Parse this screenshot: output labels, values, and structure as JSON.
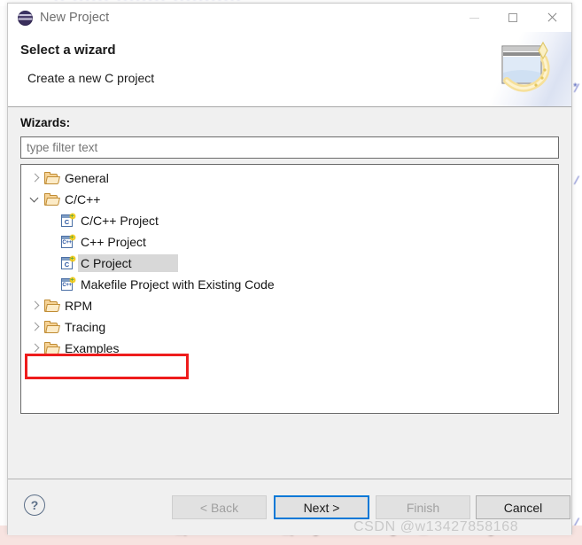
{
  "window": {
    "title": "New Project",
    "icon": "eclipse-logo",
    "controls": {
      "minimize": "—",
      "maximize": "□",
      "close": "✕"
    }
  },
  "header": {
    "title": "Select a wizard",
    "description": "Create a new C project",
    "banner_icon": "wizard-wand-window-icon"
  },
  "body": {
    "wizards_label": "Wizards:",
    "filter": {
      "placeholder": "type filter text",
      "value": ""
    },
    "tree": [
      {
        "label": "General",
        "depth": 0,
        "type": "folder",
        "state": "collapsed",
        "selected": false
      },
      {
        "label": "C/C++",
        "depth": 0,
        "type": "folder",
        "state": "expanded",
        "selected": false
      },
      {
        "label": "C/C++ Project",
        "depth": 1,
        "type": "project-c",
        "icon_letter": "C",
        "selected": false
      },
      {
        "label": "C++ Project",
        "depth": 1,
        "type": "project-cpp",
        "icon_letter": "C++",
        "selected": false
      },
      {
        "label": "C Project",
        "depth": 1,
        "type": "project-c",
        "icon_letter": "C",
        "selected": true
      },
      {
        "label": "Makefile Project with Existing Code",
        "depth": 1,
        "type": "project-cpp",
        "icon_letter": "C++",
        "selected": false
      },
      {
        "label": "RPM",
        "depth": 0,
        "type": "folder",
        "state": "collapsed",
        "selected": false
      },
      {
        "label": "Tracing",
        "depth": 0,
        "type": "folder",
        "state": "collapsed",
        "selected": false
      },
      {
        "label": "Examples",
        "depth": 0,
        "type": "folder",
        "state": "collapsed",
        "selected": false
      }
    ],
    "annotation": {
      "target": "C Project",
      "color": "#ee1c1c"
    }
  },
  "footer": {
    "help_label": "?",
    "buttons": {
      "back": {
        "label": "< Back",
        "enabled": false,
        "focused": false
      },
      "next": {
        "label": "Next >",
        "enabled": true,
        "focused": true
      },
      "finish": {
        "label": "Finish",
        "enabled": false,
        "focused": false
      },
      "cancel": {
        "label": "Cancel",
        "enabled": true,
        "focused": false
      }
    }
  },
  "background": {
    "watermark": "CSDN @w13427858168",
    "bottom_path_text": "D:/software_platform/demo_project/stm32g0b1_demo/Project/libm",
    "top_blur_text": "·· ······ ········ ···········",
    "edge_marks": [
      "/",
      "/",
      "/",
      "*"
    ]
  },
  "colors": {
    "accent": "#0078d7",
    "annotation": "#ee1c1c",
    "dialog_bg": "#f0f0f0",
    "selection": "#d8d8d8"
  }
}
